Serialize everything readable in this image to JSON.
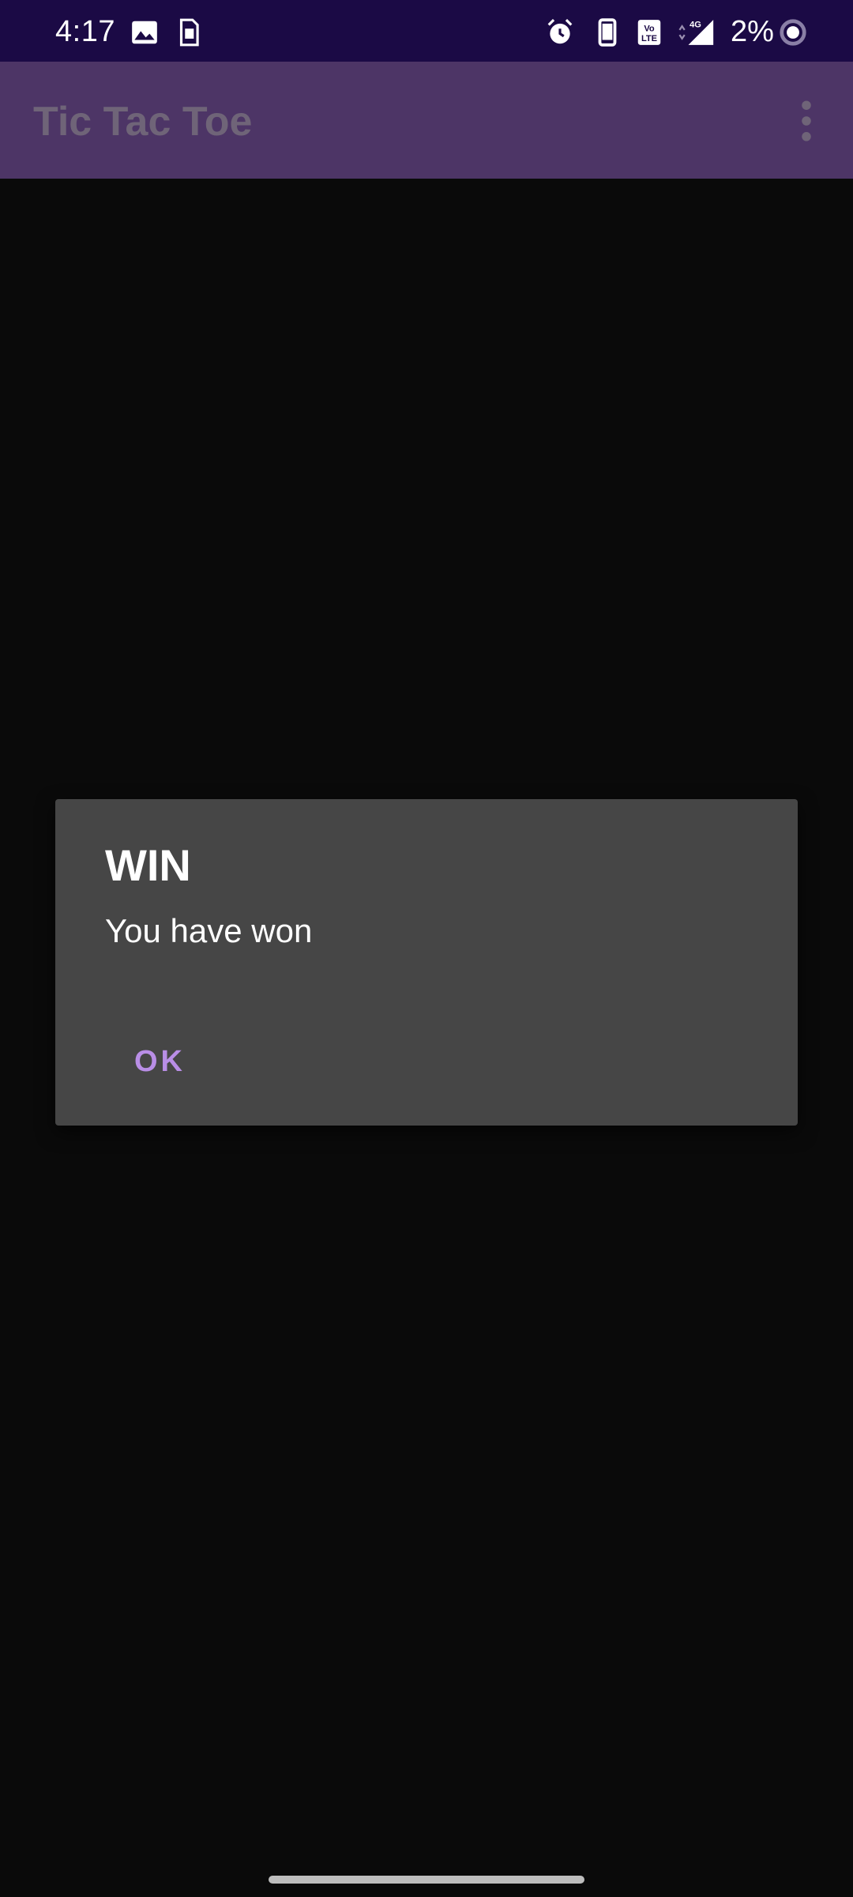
{
  "status_bar": {
    "time": "4:17",
    "battery_percent": "2%",
    "network_label": "4G",
    "icons": [
      "gallery-icon",
      "sim-card-icon",
      "alarm-icon",
      "phone-icon",
      "volte-icon",
      "signal-icon",
      "battery-ring-icon"
    ],
    "background_color": "#1b0a45"
  },
  "app_bar": {
    "title": "Tic Tac Toe",
    "menu_icon": "overflow-menu-icon",
    "background_color": "#4d3566"
  },
  "dialog": {
    "title": "WIN",
    "message": "You have won",
    "ok_label": "OK",
    "accent_color": "#b98ee6"
  }
}
